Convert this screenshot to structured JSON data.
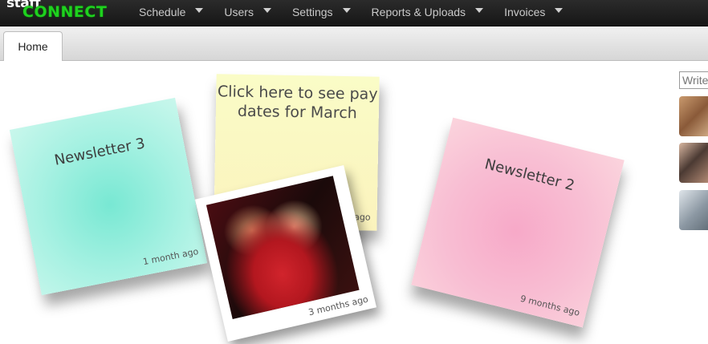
{
  "logo": {
    "line1": "staff",
    "line2": "CONNECT"
  },
  "nav": {
    "items": [
      {
        "label": "Schedule"
      },
      {
        "label": "Users"
      },
      {
        "label": "Settings"
      },
      {
        "label": "Reports & Uploads"
      },
      {
        "label": "Invoices"
      }
    ]
  },
  "tabs": [
    {
      "label": "Home",
      "active": true
    }
  ],
  "notes": [
    {
      "title": "Newsletter 3",
      "ago": "1 month ago",
      "color": "#a6f1e2"
    },
    {
      "title": "Click here to see pay dates for March",
      "ago": "1 month ago",
      "color": "#fafcc7"
    },
    {
      "title": "Newsletter 2",
      "ago": "9 months ago",
      "color": "#f8bed3"
    }
  ],
  "photo_note": {
    "ago": "3 months ago"
  },
  "sidebar": {
    "search_placeholder": "Write"
  },
  "colors": {
    "logo_green": "#1ed21e",
    "nav_bg": "#1f1f1f"
  }
}
